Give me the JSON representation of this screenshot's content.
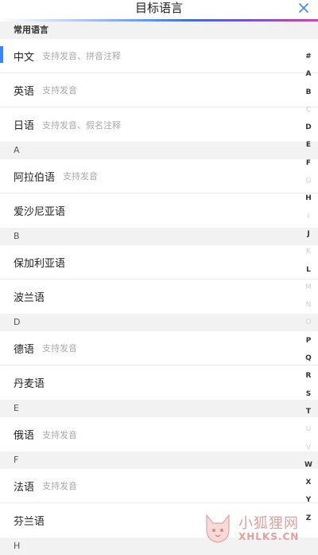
{
  "header": {
    "title": "目标语言",
    "close_icon": "close-icon"
  },
  "sections": {
    "common": {
      "title": "常用语言",
      "rows": [
        {
          "name": "中文",
          "sub": "支持发音、拼音注释"
        },
        {
          "name": "英语",
          "sub": "支持发音"
        },
        {
          "name": "日语",
          "sub": "支持发音、假名注释"
        }
      ]
    },
    "a": {
      "title": "A",
      "rows": [
        {
          "name": "阿拉伯语",
          "sub": "支持发音"
        },
        {
          "name": "爱沙尼亚语",
          "sub": ""
        }
      ]
    },
    "b": {
      "title": "B",
      "rows": [
        {
          "name": "保加利亚语",
          "sub": ""
        },
        {
          "name": "波兰语",
          "sub": ""
        }
      ]
    },
    "d": {
      "title": "D",
      "rows": [
        {
          "name": "德语",
          "sub": "支持发音"
        },
        {
          "name": "丹麦语",
          "sub": ""
        }
      ]
    },
    "e": {
      "title": "E",
      "rows": [
        {
          "name": "俄语",
          "sub": "支持发音"
        }
      ]
    },
    "f": {
      "title": "F",
      "rows": [
        {
          "name": "法语",
          "sub": "支持发音"
        },
        {
          "name": "芬兰语",
          "sub": ""
        }
      ]
    },
    "h": {
      "title": "H"
    }
  },
  "index_bar": [
    "#",
    "A",
    "B",
    "C",
    "D",
    "E",
    "F",
    "G",
    "H",
    "I",
    "J",
    "K",
    "L",
    "M",
    "N",
    "O",
    "P",
    "Q",
    "R",
    "S",
    "T",
    "U",
    "V",
    "W",
    "X",
    "Y",
    "Z"
  ],
  "index_disabled": [
    "C",
    "G",
    "I",
    "K",
    "M",
    "N",
    "O",
    "U",
    "V"
  ],
  "watermark": {
    "line1": "小狐狸网",
    "line2": "XHLKS.CN"
  },
  "colors": {
    "accent": "#3a87f5",
    "section_bg": "#f2f2f2"
  }
}
